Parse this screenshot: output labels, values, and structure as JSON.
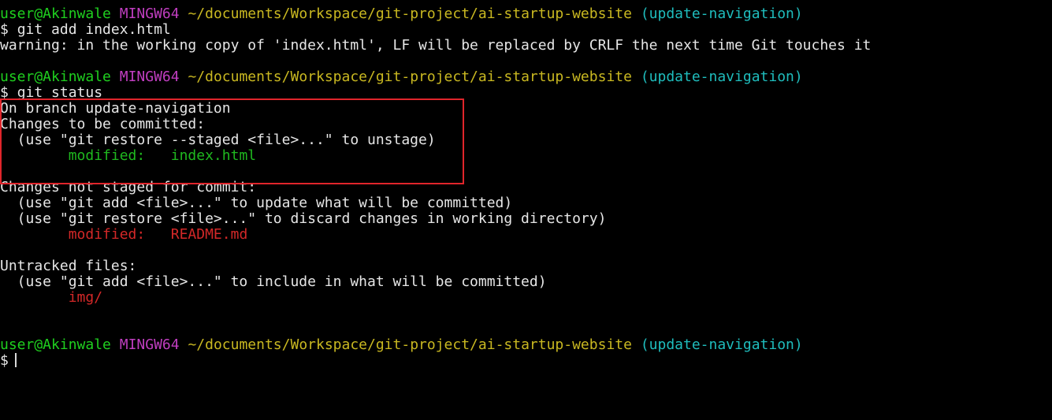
{
  "prompt": {
    "user": "user@Akinwale",
    "host": "MINGW64",
    "path": "~/documents/Workspace/git-project/ai-startup-website",
    "branch": "(update-navigation)",
    "symbol": "$"
  },
  "block1": {
    "command": "git add index.html",
    "warning": "warning: in the working copy of 'index.html', LF will be replaced by CRLF the next time Git touches it"
  },
  "block2": {
    "command": "git status",
    "on_branch": "On branch update-navigation",
    "staged_header": "Changes to be committed:",
    "staged_hint": "  (use \"git restore --staged <file>...\" to unstage)",
    "staged_status": "        modified:   ",
    "staged_file": "index.html",
    "unstaged_header": "Changes not staged for commit:",
    "unstaged_hint1": "  (use \"git add <file>...\" to update what will be committed)",
    "unstaged_hint2": "  (use \"git restore <file>...\" to discard changes in working directory)",
    "unstaged_status": "        modified:   ",
    "unstaged_file": "README.md",
    "untracked_header": "Untracked files:",
    "untracked_hint": "  (use \"git add <file>...\" to include in what will be committed)",
    "untracked_indent": "        ",
    "untracked_file": "img/"
  },
  "colors": {
    "user": "#1fd01f",
    "host": "#c03ec0",
    "path": "#c9b821",
    "branch": "#1fbdbd",
    "staged": "#1fb81f",
    "unstaged": "#d32828",
    "highlight_box": "#e0252b"
  }
}
